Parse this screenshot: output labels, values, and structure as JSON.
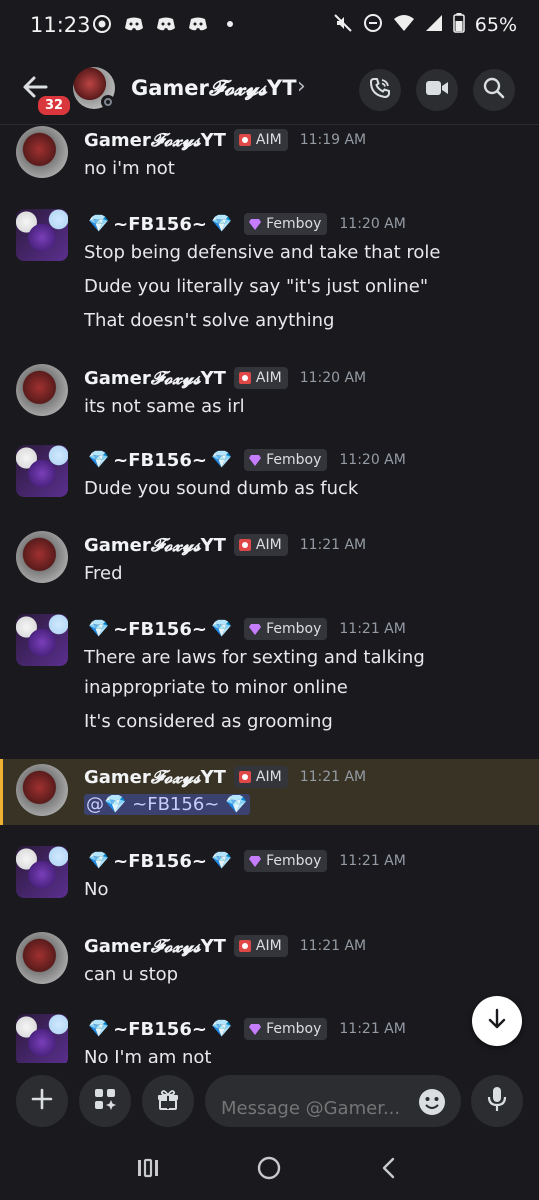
{
  "status_bar": {
    "time": "11:23",
    "battery": "65%",
    "icons": [
      "target-icon",
      "discord-icon",
      "discord-icon",
      "discord-icon",
      "dot-icon",
      "mute-icon",
      "dnd-icon",
      "wifi-icon",
      "signal-icon",
      "battery-icon"
    ]
  },
  "header": {
    "unread_badge": "32",
    "title": "GamerFoxysYT",
    "chevron": "›",
    "title_prefix": "Gamer",
    "title_script": "Foxys",
    "title_suffix": "YT"
  },
  "colors": {
    "background": "#1a1a1e",
    "highlight_bg": "#393325",
    "highlight_bar": "#f0b232",
    "mention_bg": "#3c4270",
    "badge_red": "#da373c",
    "gem_blue": "#5ec8f0"
  },
  "users": {
    "foxy": {
      "name_prefix": "Gamer",
      "name_script": "𝓕𝓸𝔁𝔂𝓼",
      "name_suffix": "YT",
      "tag": "AIM"
    },
    "fb": {
      "gem": "💎",
      "name": "~FB156~",
      "tag": "Femboy"
    }
  },
  "messages": [
    {
      "user": "foxy",
      "time": "11:19 AM",
      "lines": [
        "no i'm not"
      ]
    },
    {
      "user": "fb",
      "time": "11:20 AM",
      "lines": [
        "Stop being defensive and take that role",
        "Dude you literally say \"it's just online\"",
        "That doesn't solve anything"
      ]
    },
    {
      "user": "foxy",
      "time": "11:20 AM",
      "lines": [
        "its not same as irl"
      ]
    },
    {
      "user": "fb",
      "time": "11:20 AM",
      "lines": [
        "Dude you sound dumb as fuck"
      ]
    },
    {
      "user": "foxy",
      "time": "11:21 AM",
      "lines": [
        "Fred"
      ]
    },
    {
      "user": "fb",
      "time": "11:21 AM",
      "lines": [
        "There are laws for sexting and talking",
        "inappropriate to minor online",
        "It's considered as grooming"
      ]
    },
    {
      "user": "foxy",
      "time": "11:21 AM",
      "lines": [],
      "mention": "@💎 ~FB156~ 💎",
      "highlighted": true
    },
    {
      "user": "fb",
      "time": "11:21 AM",
      "lines": [
        "No"
      ]
    },
    {
      "user": "foxy",
      "time": "11:21 AM",
      "lines": [
        "can u stop"
      ]
    },
    {
      "user": "fb",
      "time": "11:21 AM",
      "lines": [
        "No I'm am not"
      ]
    }
  ],
  "composer": {
    "placeholder": "Message @Gamer...",
    "buttons": [
      "plus-icon",
      "apps-icon",
      "gift-icon",
      "emoji-icon",
      "microphone-icon"
    ]
  },
  "navbar": {
    "buttons": [
      "recents-icon",
      "home-icon",
      "back-icon"
    ]
  }
}
